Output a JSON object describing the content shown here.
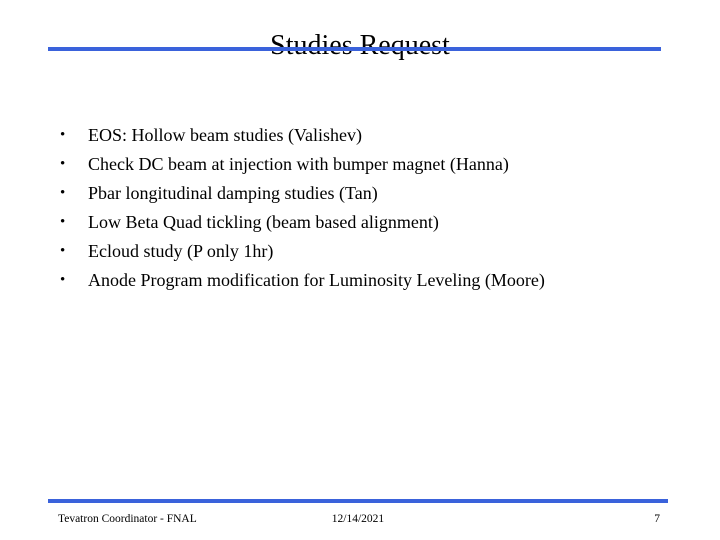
{
  "slide": {
    "title": "Studies Request",
    "accent_color": "#3a62db",
    "text_color": "#000000",
    "background_color": "#ffffff",
    "bullet_marker": "•",
    "bullets": [
      {
        "text": "EOS: Hollow beam studies (Valishev)"
      },
      {
        "text": "Check DC beam at injection with bumper magnet (Hanna)"
      },
      {
        "text": "Pbar longitudinal damping studies (Tan)"
      },
      {
        "text": "Low Beta Quad tickling (beam based alignment)"
      },
      {
        "text": "Ecloud study (P only 1hr)"
      },
      {
        "text": "Anode Program modification for Luminosity Leveling (Moore)"
      }
    ]
  },
  "footer": {
    "left": "Tevatron Coordinator - FNAL",
    "date": "12/14/2021",
    "page_number": "7"
  }
}
